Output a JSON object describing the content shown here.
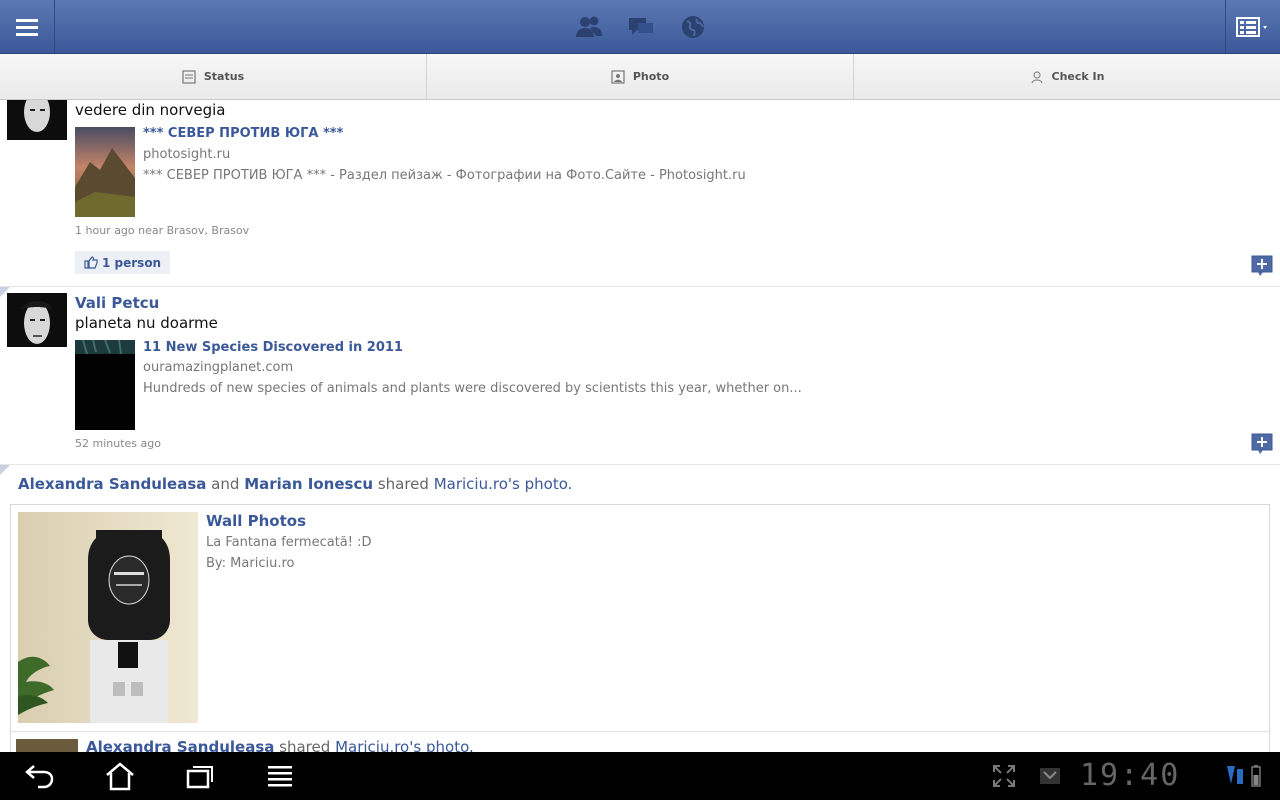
{
  "composer": {
    "status": "Status",
    "photo": "Photo",
    "checkin": "Check In"
  },
  "stories": [
    {
      "text": "vedere din norvegia",
      "link": {
        "title": "*** СЕВЕР ПРОТИВ ЮГА ***",
        "domain": "photosight.ru",
        "description": "*** СЕВЕР ПРОТИВ ЮГА *** - Раздел пейзаж - Фотографии на Фото.Сайте - Photosight.ru"
      },
      "meta": "1 hour ago near Brasov, Brasov",
      "likes": "1 person"
    },
    {
      "author": "Vali Petcu",
      "text": "planeta nu doarme",
      "link": {
        "title": "11 New Species Discovered in 2011",
        "domain": "ouramazingplanet.com",
        "description": "Hundreds of new species of animals and plants were discovered by scientists this year, whether on..."
      },
      "meta": "52 minutes ago"
    }
  ],
  "share": {
    "person1": "Alexandra Sanduleasa",
    "and": "and",
    "person2": "Marian Ionescu",
    "shared": "shared",
    "page": "Mariciu.ro",
    "possessive": "'s",
    "photo": "photo.",
    "album_title": "Wall Photos",
    "caption": "La Fantana fermecată! :D",
    "by": "By: Mariciu.ro",
    "nested": {
      "person": "Alexandra Sanduleasa",
      "shared": "shared",
      "page": "Mariciu.ro",
      "possessive": "'s",
      "photo": "photo."
    }
  },
  "statusbar": {
    "clock": "19:40"
  },
  "colors": {
    "brand": "#3b5998",
    "navbar": "#000000"
  }
}
